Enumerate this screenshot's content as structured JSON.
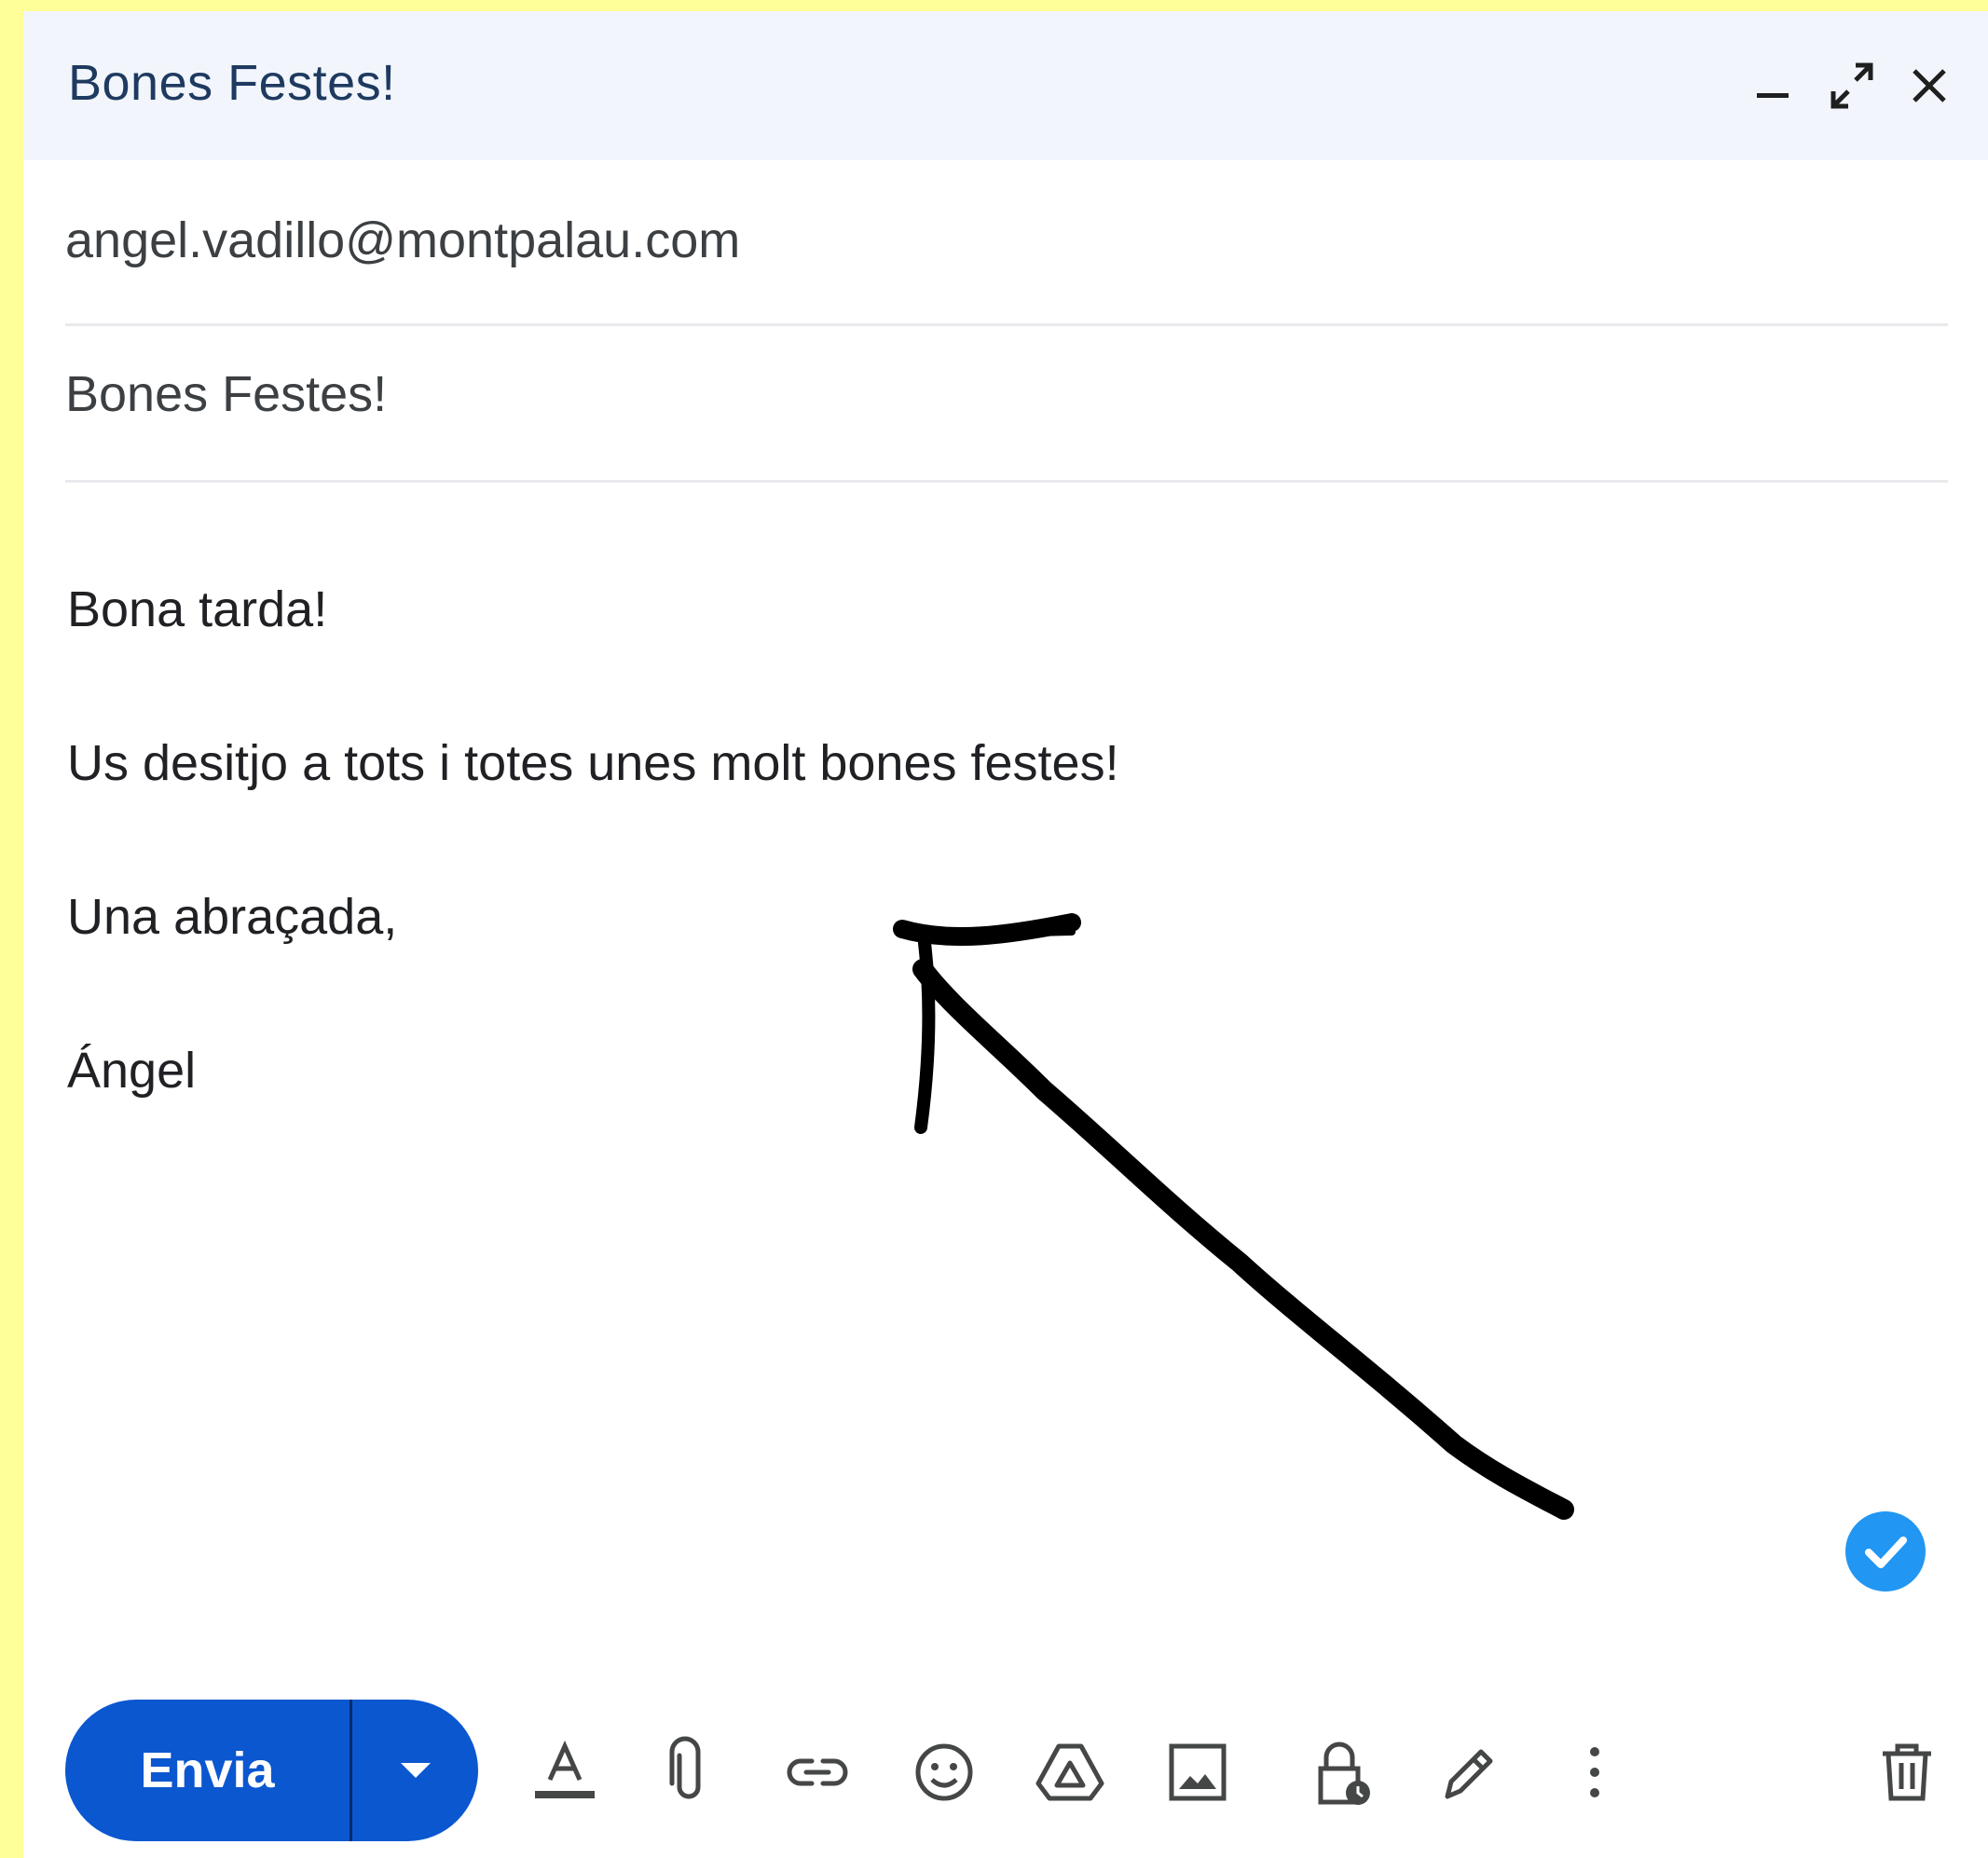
{
  "colors": {
    "page_background": "#ffff99",
    "header_background": "#f2f6fc",
    "title_color": "#1f3a60",
    "send_button": "#0b57d0",
    "check_badge": "#2196f3",
    "icon_color": "#444746"
  },
  "header": {
    "title": "Bones Festes!",
    "icons": [
      "minimize-icon",
      "expand-icon",
      "close-icon"
    ]
  },
  "fields": {
    "to_value": "angel.vadillo@montpalau.com",
    "subject_value": "Bones Festes!"
  },
  "body": {
    "lines": [
      "Bona tarda!",
      "Us desitjo a tots i totes unes molt bones festes!",
      "Una abraçada,",
      "Ángel"
    ]
  },
  "toolbar": {
    "send_label": "Envia",
    "icons": [
      "text-format-icon",
      "attach-icon",
      "link-icon",
      "emoji-icon",
      "drive-icon",
      "image-icon",
      "confidential-lock-icon",
      "signature-pen-icon",
      "more-options-icon",
      "trash-icon"
    ]
  }
}
